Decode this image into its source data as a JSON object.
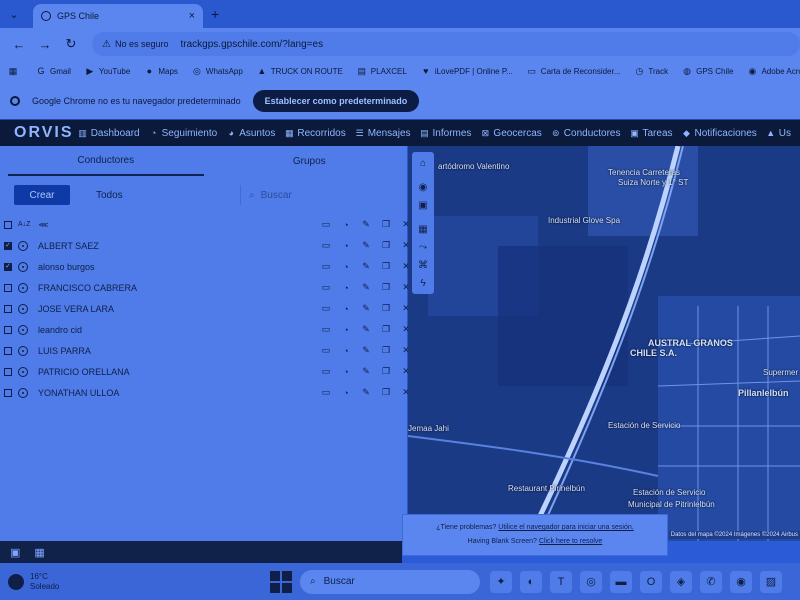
{
  "browser": {
    "tab_title": "GPS Chile",
    "new_tab": "+",
    "close": "×",
    "tab_menu": "⌄",
    "security": "No es seguro",
    "url": "trackgps.gpschile.com/?lang=es"
  },
  "bookmarks": [
    {
      "label": "",
      "icon": "apps-grid-icon",
      "glyph": "▦"
    },
    {
      "label": "Gmail",
      "icon": "google-icon",
      "glyph": "G"
    },
    {
      "label": "YouTube",
      "icon": "youtube-icon",
      "glyph": "▶"
    },
    {
      "label": "Maps",
      "icon": "maps-pin-icon",
      "glyph": "●"
    },
    {
      "label": "WhatsApp",
      "icon": "whatsapp-icon",
      "glyph": "◎"
    },
    {
      "label": "TRUCK ON ROUTE",
      "icon": "truck-icon",
      "glyph": "▲"
    },
    {
      "label": "PLAXCEL",
      "icon": "doc-icon",
      "glyph": "▤"
    },
    {
      "label": "iLovePDF | Online P...",
      "icon": "pdf-icon",
      "glyph": "♥"
    },
    {
      "label": "Carta de Reconsider...",
      "icon": "page-icon",
      "glyph": "▭"
    },
    {
      "label": "Track",
      "icon": "clock-icon",
      "glyph": "◷"
    },
    {
      "label": "GPS Chile",
      "icon": "globe-icon",
      "glyph": "◍"
    },
    {
      "label": "Adobe Acrob",
      "icon": "adobe-icon",
      "glyph": "◉"
    }
  ],
  "infobar": {
    "message": "Google Chrome no es tu navegador predeterminado",
    "button": "Establecer como predeterminado"
  },
  "app": {
    "logo": "ORVIS",
    "menu": [
      {
        "label": "Dashboard",
        "glyph": "▥",
        "icon": "dashboard-icon"
      },
      {
        "label": "Seguimiento",
        "glyph": "◔",
        "icon": "tracking-icon"
      },
      {
        "label": "Asuntos",
        "glyph": "◕",
        "icon": "issues-icon"
      },
      {
        "label": "Recorridos",
        "glyph": "▦",
        "icon": "routes-icon"
      },
      {
        "label": "Mensajes",
        "glyph": "☰",
        "icon": "messages-icon"
      },
      {
        "label": "Informes",
        "glyph": "▤",
        "icon": "reports-icon"
      },
      {
        "label": "Geocercas",
        "glyph": "⊠",
        "icon": "geofence-icon"
      },
      {
        "label": "Conductores",
        "glyph": "⊚",
        "icon": "drivers-icon"
      },
      {
        "label": "Tareas",
        "glyph": "▣",
        "icon": "tasks-icon"
      },
      {
        "label": "Notificaciones",
        "glyph": "◆",
        "icon": "notifications-icon"
      },
      {
        "label": "Us",
        "glyph": "▲",
        "icon": "users-icon"
      }
    ]
  },
  "panel": {
    "tabs": [
      "Conductores",
      "Grupos"
    ],
    "create": "Crear",
    "filter": "Todos",
    "search_placeholder": "Buscar",
    "drivers": [
      {
        "name": "ALBERT SAEZ",
        "checked": true
      },
      {
        "name": "alonso burgos",
        "checked": true
      },
      {
        "name": "FRANCISCO CABRERA",
        "checked": false
      },
      {
        "name": "JOSE VERA LARA",
        "checked": false
      },
      {
        "name": "leandro cid",
        "checked": false
      },
      {
        "name": "LUIS PARRA",
        "checked": false
      },
      {
        "name": "PATRICIO ORELLANA",
        "checked": false
      },
      {
        "name": "YONATHAN ULLOA",
        "checked": false
      }
    ]
  },
  "map": {
    "labels": [
      {
        "text": "artódromo Valentino",
        "big": false
      },
      {
        "text": "Tenencia Carreteras",
        "big": false
      },
      {
        "text": "Suiza Norte y 1° ST",
        "big": false
      },
      {
        "text": "Industrial Glove Spa",
        "big": false
      },
      {
        "text": "AUSTRAL GRANOS",
        "big": true
      },
      {
        "text": "CHILE S.A.",
        "big": true
      },
      {
        "text": "Pillanlelbún",
        "big": true
      },
      {
        "text": "Estación de Servicio",
        "big": false
      },
      {
        "text": "Restaurant Pirinelbún",
        "big": false
      },
      {
        "text": "Estación de Servicio",
        "big": false
      },
      {
        "text": "Municipal de Pitrinlelbún",
        "big": false
      },
      {
        "text": "Jemaa Jahi",
        "big": false
      },
      {
        "text": "Supermer",
        "big": false
      }
    ],
    "attribution": "Datos del mapa ©2024 Imágenes ©2024 Airbus"
  },
  "problems": {
    "question": "¿Tiene problemas?",
    "link1": "Utilice el navegador para iniciar una sesión.",
    "blank": "Having Blank Screen?",
    "link2": "Click here to resolve"
  },
  "taskbar": {
    "temp": "16°C",
    "weather": "Soleado",
    "search": "Buscar"
  }
}
